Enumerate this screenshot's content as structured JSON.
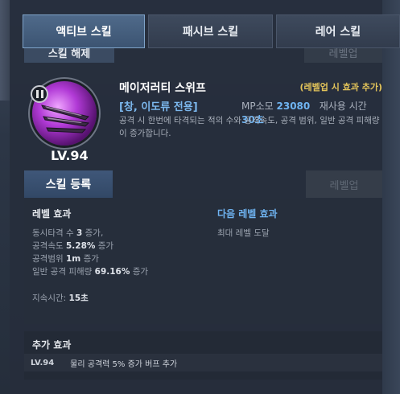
{
  "tabs": [
    {
      "label": "액티브 스킬",
      "active": true
    },
    {
      "label": "패시브 스킬",
      "active": false
    },
    {
      "label": "레어 스킬",
      "active": false
    }
  ],
  "peek": {
    "left_label": "스킬 해제",
    "right_label": "레벨업"
  },
  "skill": {
    "name": "메이저러티 스위프",
    "level": "LV.94",
    "levelup_note": "(레벨업 시 효과 추가)",
    "weapon": "[창, 이도류 전용]",
    "mp_label": "MP소모",
    "mp_value": "23080",
    "cooldown_label": "재사용 시간",
    "cooldown_value": "30초",
    "description": "공격 시 한번에 타격되는 적의 수와 공격속도, 공격 범위, 일반 공격 피해량이 증가합니다.",
    "icon": "sword-sweep-icon"
  },
  "actions": {
    "register": "스킬 등록",
    "levelup": "레벨업"
  },
  "effects": {
    "current_title": "레벨 효과",
    "next_title": "다음 레벨 효과",
    "current_lines": [
      {
        "prefix": "동시타격 수 ",
        "value": "3",
        "suffix": " 증가,"
      },
      {
        "prefix": "공격속도 ",
        "value": "5.28%",
        "suffix": " 증가"
      },
      {
        "prefix": "공격범위 ",
        "value": "1m",
        "suffix": " 증가"
      },
      {
        "prefix": "일반 공격 피해량 ",
        "value": "69.16%",
        "suffix": " 증가"
      }
    ],
    "duration_label": "지속시간:",
    "duration_value": "15초",
    "next_line": "최대 레벨 도달"
  },
  "extra": {
    "title": "추가 효과",
    "level": "LV.94",
    "text": "물리 공격력 5% 증가 버프 추가"
  },
  "colors": {
    "accent_blue": "#6fb4f2",
    "note_yellow": "#e3c45a",
    "skill_purple": "#b13ad6"
  }
}
